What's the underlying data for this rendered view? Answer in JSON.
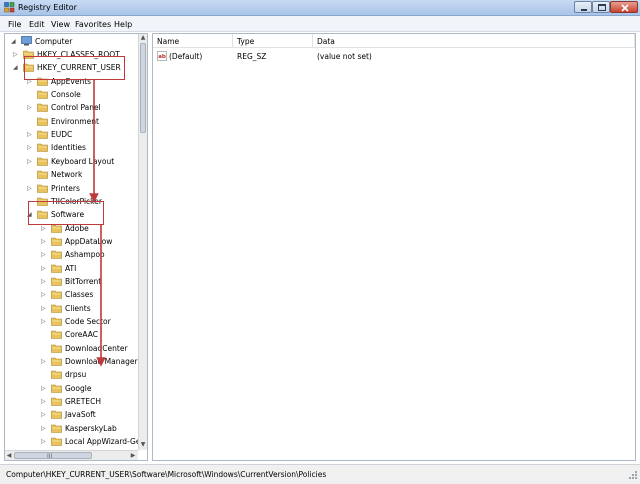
{
  "window": {
    "title": "Registry Editor",
    "controls": {
      "minimize": "minimize",
      "maximize": "maximize",
      "close": "close"
    }
  },
  "menu": [
    "File",
    "Edit",
    "View",
    "Favorites",
    "Help"
  ],
  "tree": {
    "root": "Computer",
    "items": [
      {
        "label": "HKEY_CLASSES_ROOT",
        "depth": 1,
        "twisty": "collapsed"
      },
      {
        "label": "HKEY_CURRENT_USER",
        "depth": 1,
        "twisty": "expanded"
      },
      {
        "label": "AppEvents",
        "depth": 2,
        "twisty": "collapsed"
      },
      {
        "label": "Console",
        "depth": 2,
        "twisty": "none"
      },
      {
        "label": "Control Panel",
        "depth": 2,
        "twisty": "collapsed"
      },
      {
        "label": "Environment",
        "depth": 2,
        "twisty": "none"
      },
      {
        "label": "EUDC",
        "depth": 2,
        "twisty": "collapsed"
      },
      {
        "label": "Identities",
        "depth": 2,
        "twisty": "collapsed"
      },
      {
        "label": "Keyboard Layout",
        "depth": 2,
        "twisty": "collapsed"
      },
      {
        "label": "Network",
        "depth": 2,
        "twisty": "none"
      },
      {
        "label": "Printers",
        "depth": 2,
        "twisty": "collapsed"
      },
      {
        "label": "TIIColorPicker",
        "depth": 2,
        "twisty": "none"
      },
      {
        "label": "Software",
        "depth": 2,
        "twisty": "expanded"
      },
      {
        "label": "Adobe",
        "depth": 3,
        "twisty": "collapsed"
      },
      {
        "label": "AppDataLow",
        "depth": 3,
        "twisty": "collapsed"
      },
      {
        "label": "Ashampoo",
        "depth": 3,
        "twisty": "collapsed"
      },
      {
        "label": "ATI",
        "depth": 3,
        "twisty": "collapsed"
      },
      {
        "label": "BitTorrent",
        "depth": 3,
        "twisty": "collapsed"
      },
      {
        "label": "Classes",
        "depth": 3,
        "twisty": "collapsed"
      },
      {
        "label": "Clients",
        "depth": 3,
        "twisty": "collapsed"
      },
      {
        "label": "Code Sector",
        "depth": 3,
        "twisty": "collapsed"
      },
      {
        "label": "CoreAAC",
        "depth": 3,
        "twisty": "none"
      },
      {
        "label": "DownloadCenter",
        "depth": 3,
        "twisty": "none"
      },
      {
        "label": "Download Manager",
        "depth": 3,
        "twisty": "collapsed"
      },
      {
        "label": "drpsu",
        "depth": 3,
        "twisty": "none"
      },
      {
        "label": "Google",
        "depth": 3,
        "twisty": "collapsed"
      },
      {
        "label": "GRETECH",
        "depth": 3,
        "twisty": "collapsed"
      },
      {
        "label": "JavaSoft",
        "depth": 3,
        "twisty": "collapsed"
      },
      {
        "label": "KasperskyLab",
        "depth": 3,
        "twisty": "collapsed"
      },
      {
        "label": "Local AppWizard-Ge",
        "depth": 3,
        "twisty": "collapsed"
      }
    ],
    "hscroll_grip": "III"
  },
  "list": {
    "columns": [
      "Name",
      "Type",
      "Data"
    ],
    "rows": [
      {
        "name": "(Default)",
        "type": "REG_SZ",
        "data": "(value not set)",
        "icon": "string-value-icon"
      }
    ]
  },
  "status": {
    "path": "Computer\\HKEY_CURRENT_USER\\Software\\Microsoft\\Windows\\CurrentVersion\\Policies"
  },
  "colors": {
    "annotation": "#c0393b",
    "folder": "#e8c25a"
  }
}
